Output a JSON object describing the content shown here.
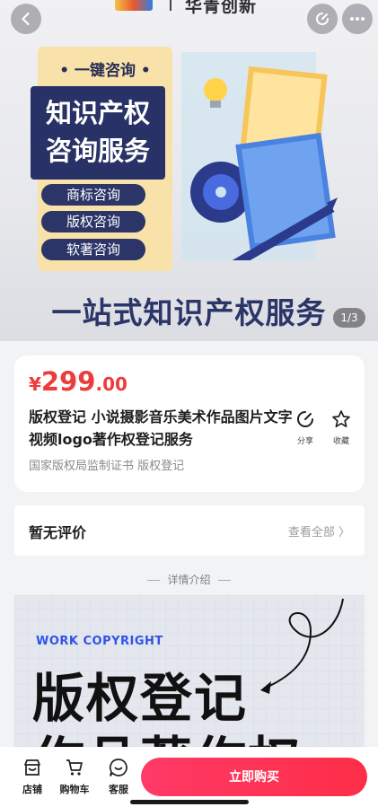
{
  "header": {
    "brand_name": "华青创新",
    "icons": [
      "back-icon",
      "share-icon",
      "more-icon"
    ]
  },
  "banner": {
    "tag": "• 一键咨询 •",
    "title_line1": "知识产权",
    "title_line2": "咨询服务",
    "services": [
      "商标咨询",
      "版权咨询",
      "软著咨询"
    ],
    "slogan": "一站式知识产权服务",
    "pager": "1/3"
  },
  "product": {
    "currency": "¥",
    "price_int": "299",
    "price_dec": ".00",
    "title": "版权登记 小说摄影音乐美术作品图片文字视频logo著作权登记服务",
    "subtitle": "国家版权局监制证书 版权登记",
    "share_label": "分享",
    "fav_label": "收藏"
  },
  "reviews": {
    "title": "暂无评价",
    "link": "查看全部 〉"
  },
  "detail": {
    "section_label": "详情介绍",
    "tag": "WORK COPYRIGHT",
    "heading1": "版权登记",
    "heading2": "作品著作权"
  },
  "bottom_bar": {
    "shop_label": "店铺",
    "cart_label": "购物车",
    "service_label": "客服",
    "buy_label": "立即购买"
  },
  "colors": {
    "accent": "#ee3b3b",
    "buy_button": "#fd2d47",
    "banner_navy": "#283266",
    "banner_yellow": "#f9e2a9"
  }
}
